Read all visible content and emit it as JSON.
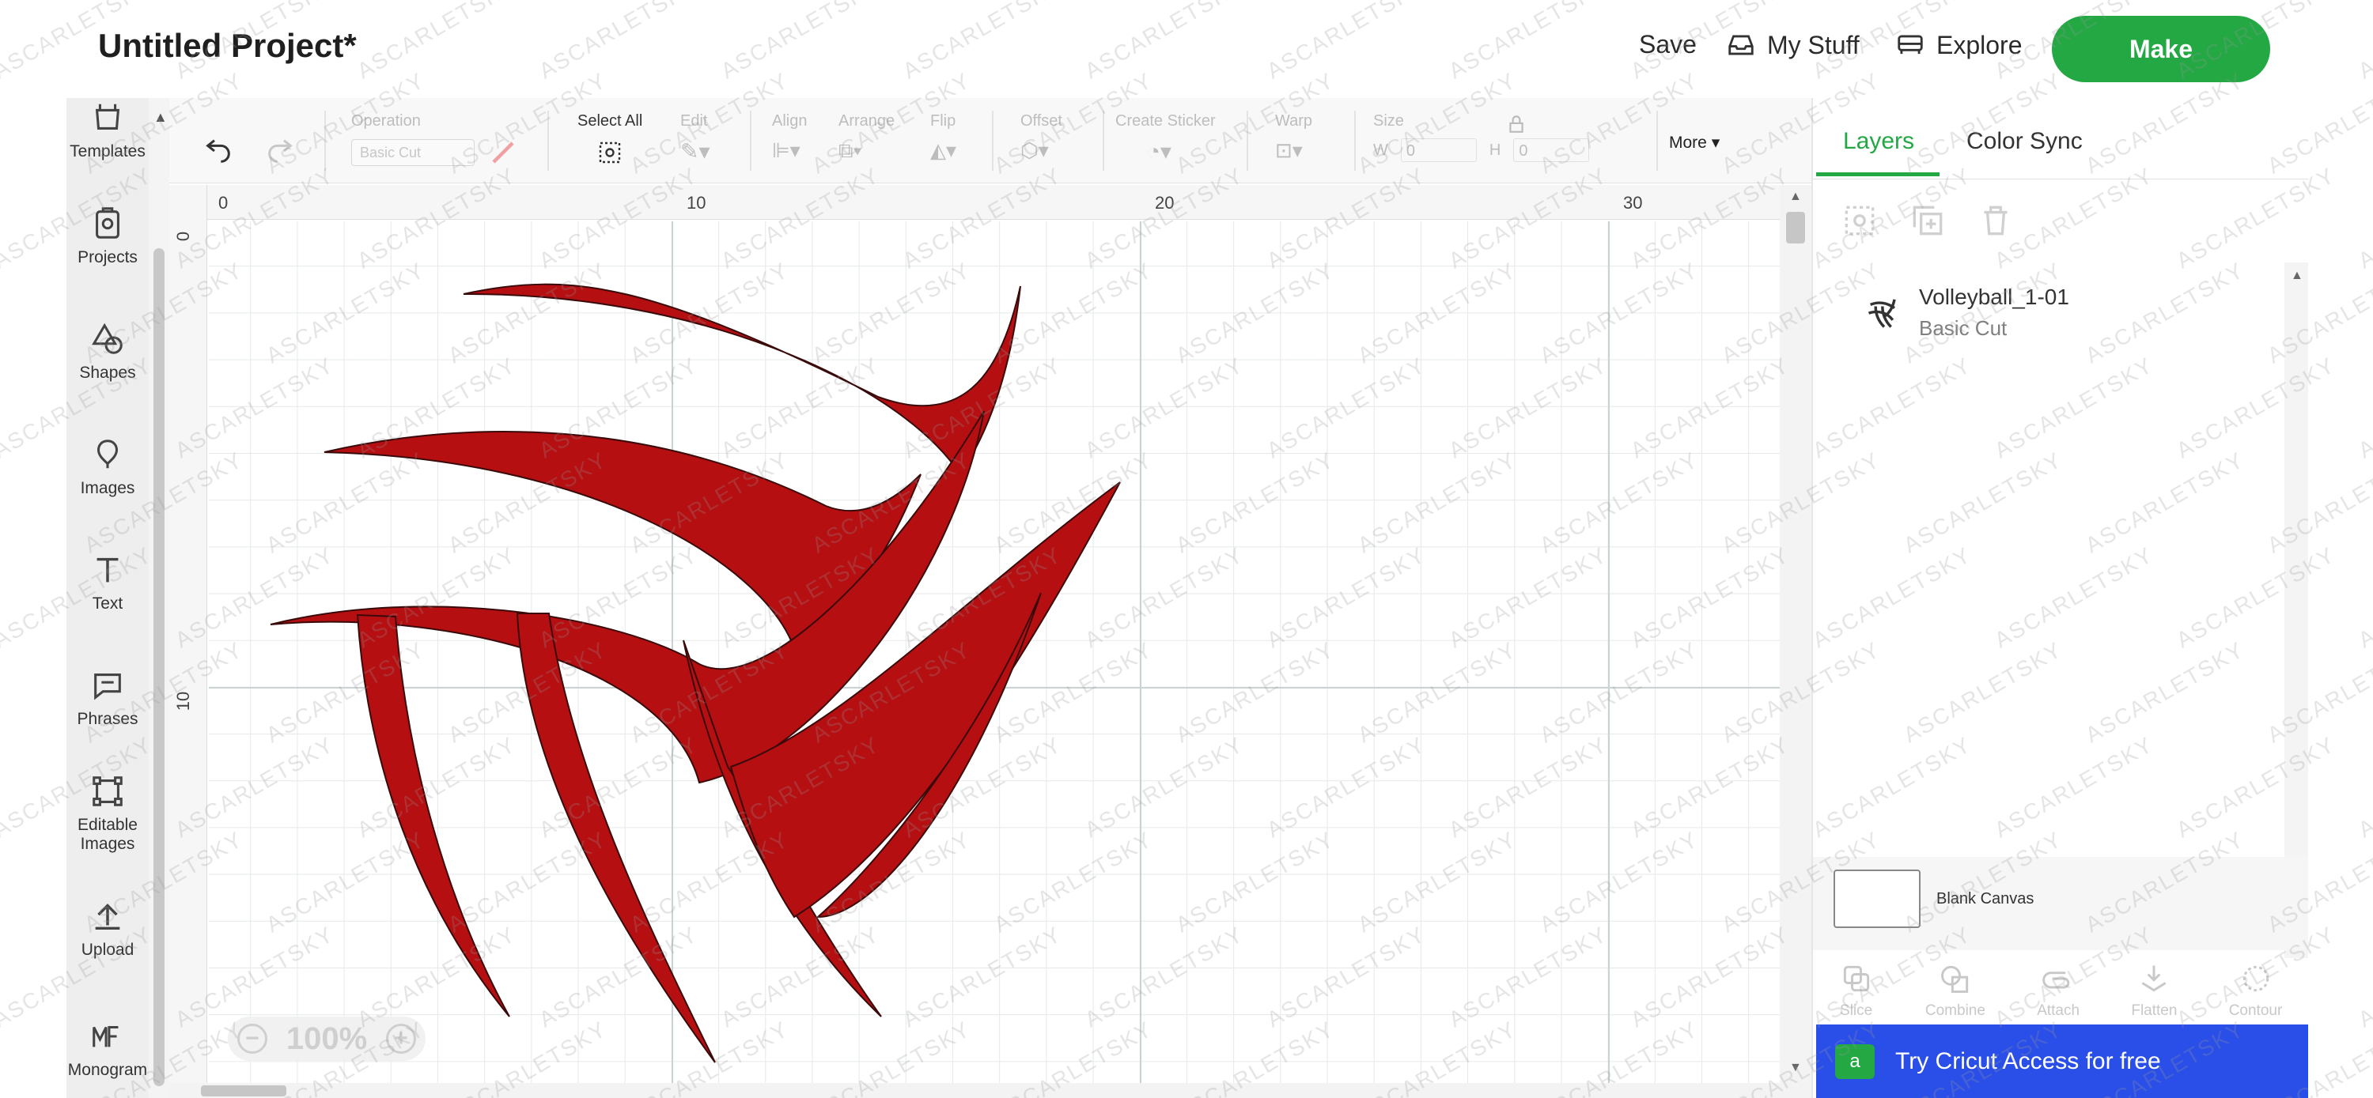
{
  "header": {
    "title": "Untitled Project*",
    "save": "Save",
    "my_stuff": "My Stuff",
    "explore": "Explore",
    "make": "Make"
  },
  "sidebar": {
    "items": [
      {
        "label": "Templates",
        "icon": "templates-icon"
      },
      {
        "label": "Projects",
        "icon": "projects-icon"
      },
      {
        "label": "Shapes",
        "icon": "shapes-icon"
      },
      {
        "label": "Images",
        "icon": "images-icon"
      },
      {
        "label": "Text",
        "icon": "text-icon"
      },
      {
        "label": "Phrases",
        "icon": "phrases-icon"
      },
      {
        "label": "Editable Images",
        "icon": "editable-images-icon"
      },
      {
        "label": "Upload",
        "icon": "upload-icon"
      },
      {
        "label": "Monogram",
        "icon": "monogram-icon"
      }
    ]
  },
  "toolbar": {
    "operation_label": "Operation",
    "operation_value": "Basic Cut",
    "select_all": "Select All",
    "edit": "Edit",
    "align": "Align",
    "arrange": "Arrange",
    "flip": "Flip",
    "offset": "Offset",
    "create_sticker": "Create Sticker",
    "warp": "Warp",
    "size": "Size",
    "w": "W",
    "w_value": "0",
    "h": "H",
    "h_value": "0",
    "more": "More"
  },
  "ruler": {
    "top_ticks": [
      "0",
      "10",
      "20",
      "30"
    ],
    "left_ticks": [
      "0",
      "10"
    ]
  },
  "canvas": {
    "zoom": "100%",
    "zoom_out": "−",
    "zoom_in": "+",
    "design_color": "#b50f12"
  },
  "right_panel": {
    "tabs": [
      "Layers",
      "Color Sync"
    ],
    "active_tab": "Layers",
    "layer": {
      "name": "Volleyball_1-01",
      "operation": "Basic Cut"
    },
    "blank_canvas": "Blank Canvas",
    "bottom_tools": [
      "Slice",
      "Combine",
      "Attach",
      "Flatten",
      "Contour"
    ],
    "banner": "Try Cricut Access for free"
  },
  "watermark": "ASCARLETSKY",
  "colors": {
    "accent_green": "#23a844",
    "banner_blue": "#2a4fe8"
  }
}
